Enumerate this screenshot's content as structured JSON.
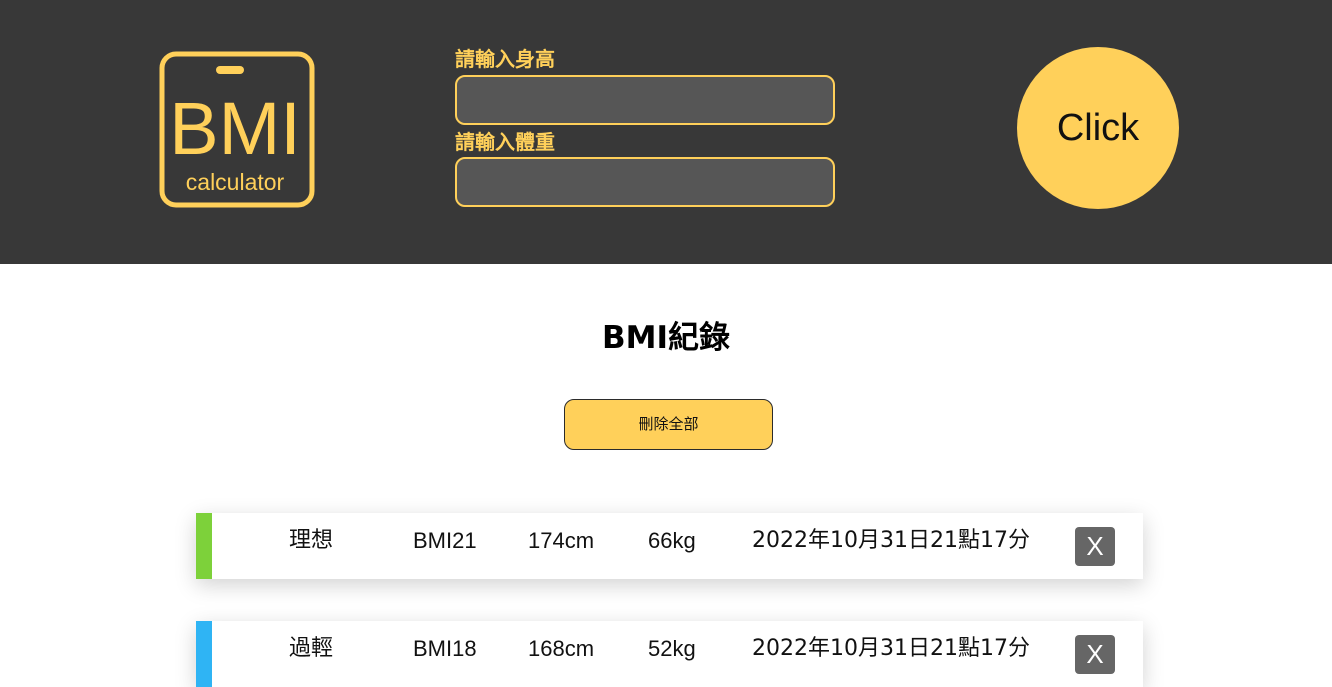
{
  "header": {
    "logo": {
      "main_text": "BMI",
      "sub_text": "calculator"
    },
    "height_label": "請輸入身高",
    "height_value": "",
    "weight_label": "請輸入體重",
    "weight_value": "",
    "submit_label": "Click"
  },
  "main": {
    "title": "BMI紀錄",
    "delete_all_label": "刪除全部",
    "records": [
      {
        "status": "理想",
        "bmi": "BMI21",
        "height": "174cm",
        "weight": "66kg",
        "time": "2022年10月31日21點17分",
        "color": "#7dd13a",
        "delete_label": "X"
      },
      {
        "status": "過輕",
        "bmi": "BMI18",
        "height": "168cm",
        "weight": "52kg",
        "time": "2022年10月31日21點17分",
        "color": "#2fb4f4",
        "delete_label": "X"
      }
    ]
  },
  "colors": {
    "header_bg": "#383838",
    "accent": "#ffd05a",
    "input_bg": "#565656",
    "delete_bg": "#666666"
  }
}
